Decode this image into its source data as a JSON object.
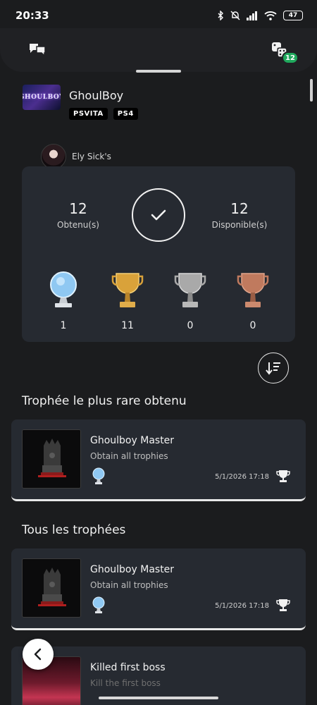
{
  "status_bar": {
    "time": "20:33",
    "battery": "47"
  },
  "top_bar": {
    "notification_count": "12"
  },
  "game": {
    "title": "GhoulBoy",
    "thumb_text": "GHOULBOY",
    "platforms": [
      "PSVITA",
      "PS4"
    ]
  },
  "user": {
    "name": "Ely Sick's"
  },
  "summary": {
    "earned": "12",
    "earned_label": "Obtenu(s)",
    "available": "12",
    "available_label": "Disponible(s)",
    "platinum": "1",
    "gold": "11",
    "silver": "0",
    "bronze": "0"
  },
  "sections": {
    "rarest": "Trophée le plus rare obtenu",
    "all": "Tous les trophées"
  },
  "rarest_trophy": {
    "name": "Ghoulboy Master",
    "description": "Obtain all trophies",
    "date": "5/1/2026  17:18",
    "grade": "platinum"
  },
  "trophies": [
    {
      "name": "Ghoulboy Master",
      "description": "Obtain all trophies",
      "date": "5/1/2026  17:18",
      "grade": "platinum"
    },
    {
      "name": "Killed first boss",
      "description": "Kill the first boss"
    }
  ],
  "colors": {
    "background": "#1b1c1e",
    "card": "#262a31",
    "badge_green": "#1fa85c",
    "platinum": "#8fc8f2",
    "gold": "#d9a23a",
    "silver": "#a9a9a9",
    "bronze": "#c07a5e"
  },
  "icons": [
    "chat-bubbles-icon",
    "dice-icon",
    "checkmark-icon",
    "sort-icon",
    "back-chevron-icon",
    "trophy-icon"
  ]
}
